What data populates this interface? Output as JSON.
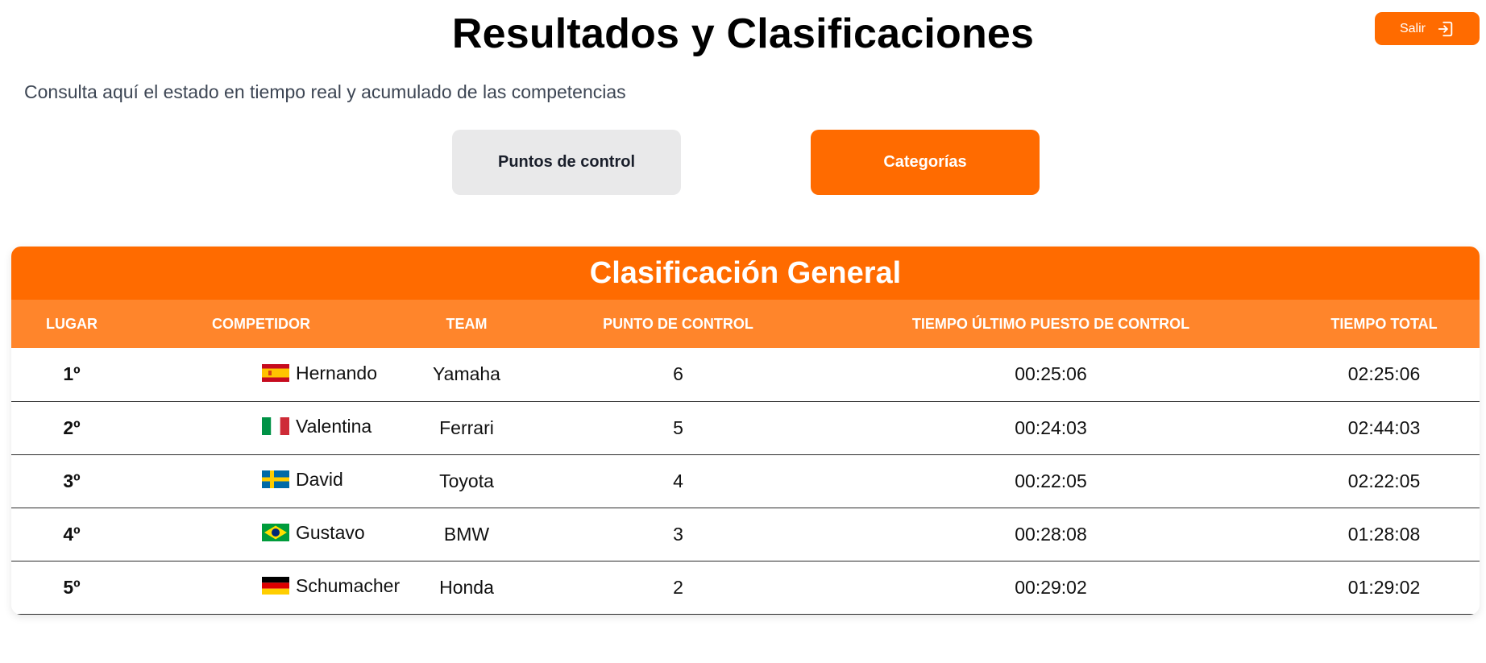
{
  "header": {
    "title": "Resultados y Clasificaciones",
    "logout_label": "Salir",
    "logout_icon": "logout-icon"
  },
  "subtitle": "Consulta aquí el estado en tiempo real y acumulado de las competencias",
  "tabs": [
    {
      "label": "Puntos de control",
      "active": false
    },
    {
      "label": "Categorías",
      "active": true
    }
  ],
  "table": {
    "title": "Clasificación General",
    "columns": [
      "LUGAR",
      "COMPETIDOR",
      "TEAM",
      "PUNTO DE CONTROL",
      "TIEMPO ÚLTIMO PUESTO DE CONTROL",
      "TIEMPO TOTAL"
    ],
    "rows": [
      {
        "place": "1º",
        "flag": "spain-flag",
        "competitor": "Hernando",
        "team": "Yamaha",
        "checkpoint": "6",
        "last_time": "00:25:06",
        "total_time": "02:25:06"
      },
      {
        "place": "2º",
        "flag": "italy-flag",
        "competitor": "Valentina",
        "team": "Ferrari",
        "checkpoint": "5",
        "last_time": "00:24:03",
        "total_time": "02:44:03"
      },
      {
        "place": "3º",
        "flag": "sweden-flag",
        "competitor": "David",
        "team": "Toyota",
        "checkpoint": "4",
        "last_time": "00:22:05",
        "total_time": "02:22:05"
      },
      {
        "place": "4º",
        "flag": "brazil-flag",
        "competitor": "Gustavo",
        "team": "BMW",
        "checkpoint": "3",
        "last_time": "00:28:08",
        "total_time": "01:28:08"
      },
      {
        "place": "5º",
        "flag": "germany-flag",
        "competitor": "Schumacher",
        "team": "Honda",
        "checkpoint": "2",
        "last_time": "00:29:02",
        "total_time": "01:29:02"
      }
    ]
  },
  "colors": {
    "accent": "#ff6b00",
    "header_row": "#ff852b",
    "inactive_tab": "#e9e9ea"
  }
}
